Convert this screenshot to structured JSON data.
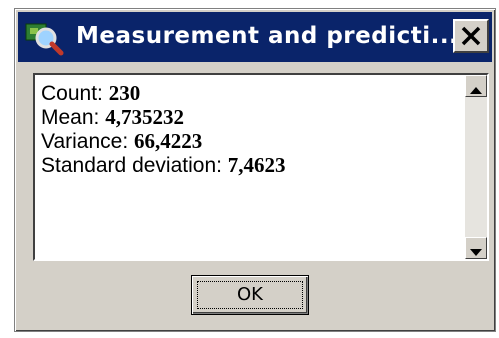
{
  "window": {
    "title": "Measurement and predicti...",
    "icon": "measurement-app-icon",
    "close_icon": "close-icon"
  },
  "stats": [
    {
      "label": "Count: ",
      "value": "230"
    },
    {
      "label": "Mean: ",
      "value": "4,735232"
    },
    {
      "label": "Variance: ",
      "value": "66,4223"
    },
    {
      "label": "Standard deviation: ",
      "value": "7,4623"
    }
  ],
  "scrollbar": {
    "up_icon": "scroll-up-arrow-icon",
    "down_icon": "scroll-down-arrow-icon"
  },
  "buttons": {
    "ok_label": "OK"
  },
  "colors": {
    "titlebar": "#0a246a",
    "face": "#d4d0c8"
  }
}
